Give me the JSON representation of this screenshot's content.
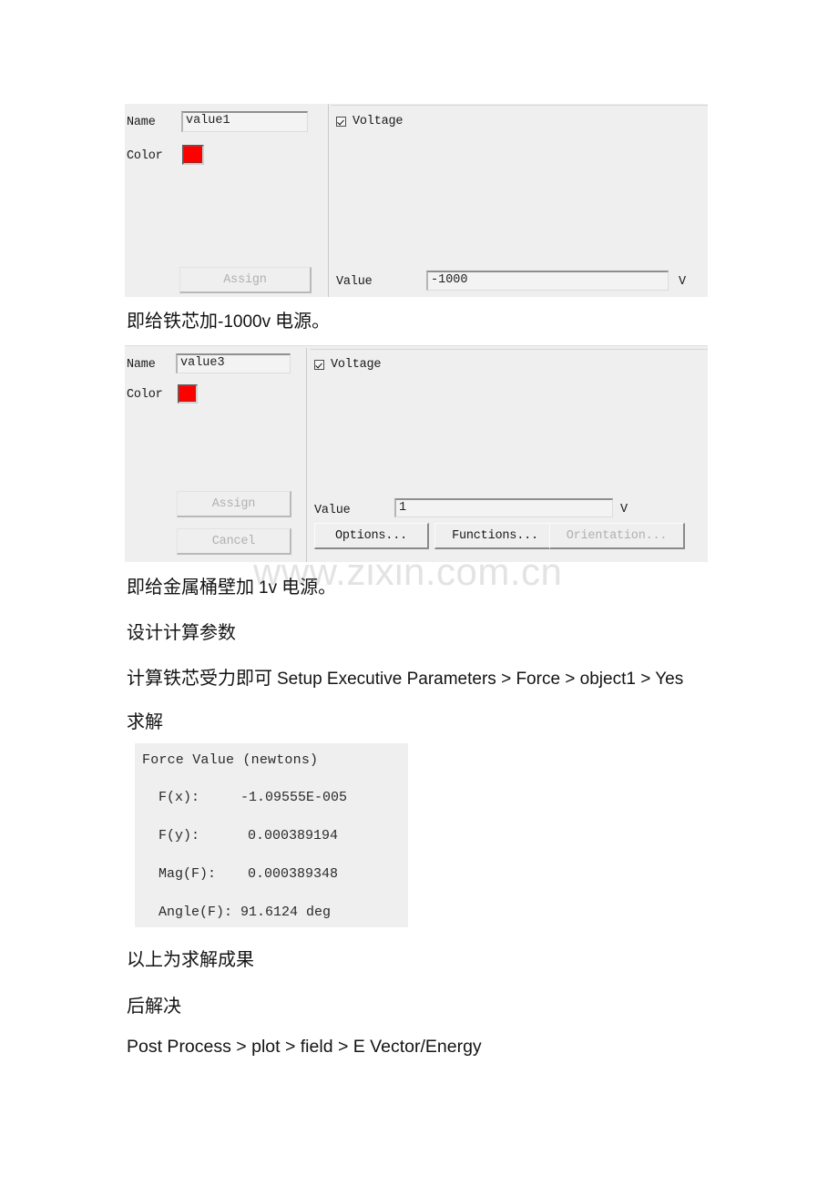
{
  "document": {
    "watermark": "www.zixin.com.cn",
    "paragraphs": [
      {
        "id": "p1",
        "cn": "即给铁芯加",
        "latin": "-1000v",
        "cn_tail": " 电源。"
      },
      {
        "id": "p2",
        "cn": "即给金属桶壁加 ",
        "latin": "1v",
        "cn_tail": " 电源。"
      },
      {
        "id": "p3",
        "cn": "设计计算参数",
        "latin": "",
        "cn_tail": ""
      },
      {
        "id": "p4",
        "cn": "计算铁芯受力即可 ",
        "latin": "Setup Executive Parameters > Force > object1 > Yes",
        "cn_tail": ""
      },
      {
        "id": "p5",
        "cn": "求解",
        "latin": "",
        "cn_tail": ""
      },
      {
        "id": "p6",
        "cn": "以上为求解成果",
        "latin": "",
        "cn_tail": ""
      },
      {
        "id": "p7",
        "cn": "后解决",
        "latin": "",
        "cn_tail": ""
      },
      {
        "id": "p8",
        "cn": "",
        "latin": "Post Process > plot > field > E Vector/Energy",
        "cn_tail": ""
      }
    ]
  },
  "dialog1": {
    "name_label": "Name",
    "name_value": "value1",
    "color_label": "Color",
    "color_value": "#ff0000",
    "assign_label": "Assign",
    "voltage_checkbox_label": "Voltage",
    "voltage_checked": true,
    "value_label": "Value",
    "value_value": "-1000",
    "value_unit": "V"
  },
  "dialog2": {
    "name_label": "Name",
    "name_value": "value3",
    "color_label": "Color",
    "color_value": "#ff0000",
    "assign_label": "Assign",
    "cancel_label": "Cancel",
    "voltage_checkbox_label": "Voltage",
    "voltage_checked": true,
    "value_label": "Value",
    "value_value": "1",
    "value_unit": "V",
    "options_label": "Options...",
    "functions_label": "Functions...",
    "orientation_label": "Orientation..."
  },
  "force_result": {
    "title": "Force Value (newtons)",
    "rows": [
      {
        "label": "F(x):",
        "value": "-1.09555E-005"
      },
      {
        "label": "F(y):",
        "value": "0.000389194"
      },
      {
        "label": "Mag(F):",
        "value": "0.000389348"
      },
      {
        "label": "Angle(F):",
        "value": "91.6124 deg"
      }
    ]
  }
}
